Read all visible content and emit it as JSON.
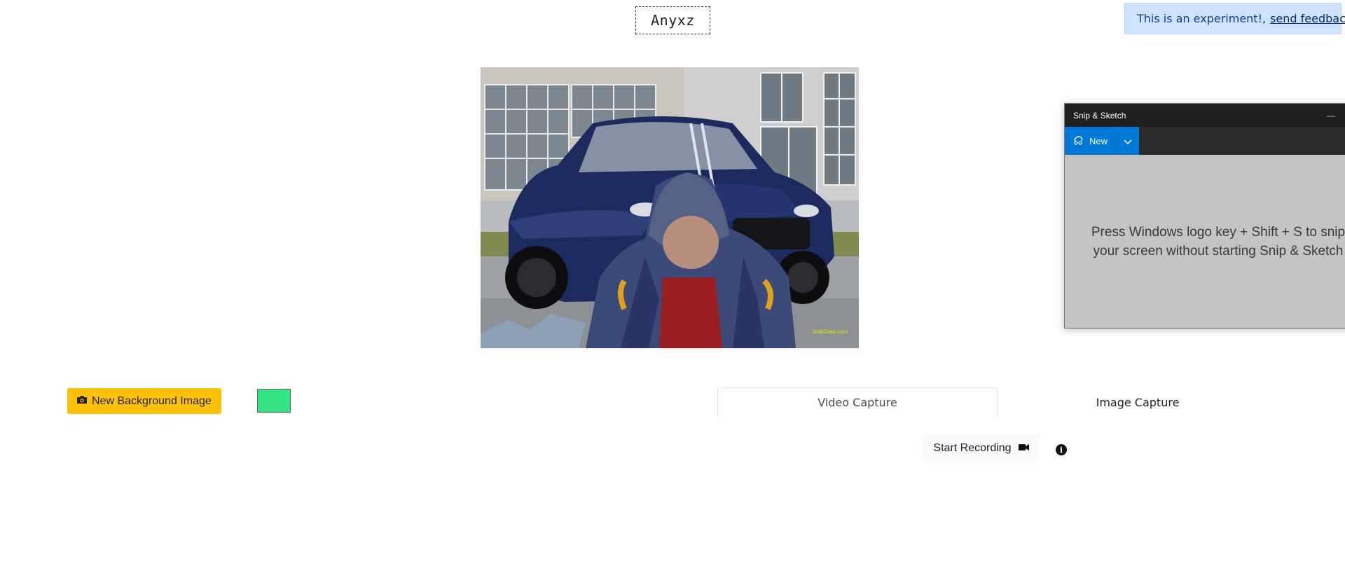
{
  "app": {
    "title": "Anyxz"
  },
  "feedback": {
    "text": "This is an experiment!,",
    "link_label": "send feedback"
  },
  "preview": {
    "watermark": "GabGrab.com"
  },
  "snip": {
    "window_title": "Snip & Sketch",
    "minimize_glyph": "—",
    "new_label": "New",
    "hint_line1": "Press Windows logo key + Shift + S to snip",
    "hint_line2": "your screen without starting Snip & Sketch"
  },
  "controls": {
    "bg_button_label": "New Background Image",
    "swatch_color": "#35e584"
  },
  "tabs": [
    {
      "label": "Video Capture",
      "active": true
    },
    {
      "label": "Image Capture",
      "active": false
    }
  ],
  "recording": {
    "start_label": "Start Recording",
    "info_glyph": "i"
  },
  "icons": {
    "bg_button": "camera-icon",
    "record": "video-camera-icon",
    "snip_new": "snip-icon",
    "snip_dropdown": "chevron-down-icon",
    "info": "info-icon"
  }
}
